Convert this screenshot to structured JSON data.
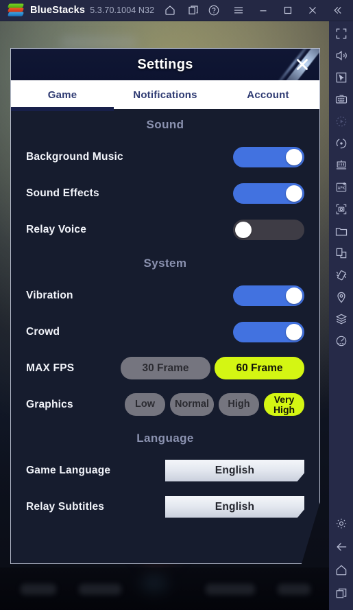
{
  "bluestacks": {
    "app_name": "BlueStacks",
    "version": "5.3.70.1004 N32",
    "left_icons": [
      {
        "name": "home-icon",
        "label": "Home"
      },
      {
        "name": "multi-instance-icon",
        "label": "Instances"
      }
    ],
    "right_icons": [
      {
        "name": "help-icon",
        "label": "Help"
      },
      {
        "name": "menu-icon",
        "label": "Menu"
      },
      {
        "name": "minimize-icon",
        "label": "Minimize"
      },
      {
        "name": "maximize-icon",
        "label": "Maximize"
      },
      {
        "name": "close-icon",
        "label": "Close"
      },
      {
        "name": "collapse-icon",
        "label": "Collapse"
      }
    ]
  },
  "sidebar": {
    "items": [
      {
        "name": "fullscreen-icon",
        "label": "Full screen"
      },
      {
        "name": "volume-icon",
        "label": "Volume"
      },
      {
        "name": "cursor-icon",
        "label": "Pointer"
      },
      {
        "name": "keyboard-icon",
        "label": "Game controls"
      },
      {
        "name": "record-icon",
        "label": "Record",
        "dim": true
      },
      {
        "name": "rotate-icon",
        "label": "Rotate"
      },
      {
        "name": "multi-instance-manager-icon",
        "label": "Multi-instance manager"
      },
      {
        "name": "install-apk-icon",
        "label": "Install APK"
      },
      {
        "name": "screenshot-icon",
        "label": "Screenshot"
      },
      {
        "name": "folder-icon",
        "label": "Media manager"
      },
      {
        "name": "copy-icon",
        "label": "Copy to PC"
      },
      {
        "name": "shake-icon",
        "label": "Shake"
      },
      {
        "name": "location-icon",
        "label": "Location"
      },
      {
        "name": "macro-icon",
        "label": "Macros"
      },
      {
        "name": "performance-icon",
        "label": "Performance"
      }
    ],
    "bottom_items": [
      {
        "name": "gear-icon",
        "label": "Settings"
      },
      {
        "name": "back-icon",
        "label": "Back"
      },
      {
        "name": "home-icon",
        "label": "Home"
      },
      {
        "name": "recents-icon",
        "label": "Recent apps"
      }
    ]
  },
  "dialog": {
    "title": "Settings",
    "close_label": "Close",
    "tabs": [
      {
        "label": "Game",
        "active": true
      },
      {
        "label": "Notifications",
        "active": false
      },
      {
        "label": "Account",
        "active": false
      }
    ],
    "sections": [
      {
        "title": "Sound",
        "rows": [
          {
            "label": "Background Music",
            "type": "toggle",
            "value": "on"
          },
          {
            "label": "Sound Effects",
            "type": "toggle",
            "value": "on"
          },
          {
            "label": "Relay Voice",
            "type": "toggle",
            "value": "off"
          }
        ]
      },
      {
        "title": "System",
        "rows": [
          {
            "label": "Vibration",
            "type": "toggle",
            "value": "on"
          },
          {
            "label": "Crowd",
            "type": "toggle",
            "value": "on"
          },
          {
            "label": "MAX FPS",
            "type": "pills",
            "options": [
              "30 Frame",
              "60 Frame"
            ],
            "selected": "60 Frame"
          },
          {
            "label": "Graphics",
            "type": "pills",
            "options": [
              "Low",
              "Normal",
              "High",
              "Very High"
            ],
            "selected": "Very High"
          }
        ]
      },
      {
        "title": "Language",
        "rows": [
          {
            "label": "Game Language",
            "type": "button",
            "value": "English"
          },
          {
            "label": "Relay Subtitles",
            "type": "button",
            "value": "English"
          }
        ]
      }
    ]
  },
  "colors": {
    "toggle_on": "#4272e0",
    "toggle_off": "#3e3c45",
    "accent_selected": "#d4f613",
    "pill_unselected": "#75757f",
    "dialog_bg": "#161c2e",
    "titlebar_bg": "#242844",
    "section_title": "#8b92b0"
  }
}
